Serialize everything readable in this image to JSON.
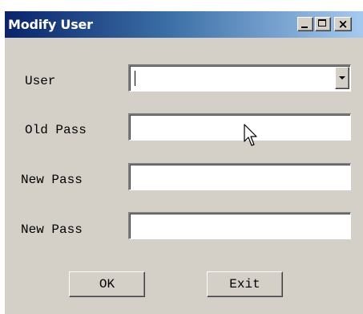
{
  "window": {
    "title": "Modify User",
    "titlebar_gradient": [
      "#0a246a",
      "#a6caf0"
    ],
    "background": "#d4d0c8"
  },
  "title_buttons": {
    "minimize_icon": "minimize-icon",
    "maximize_icon": "maximize-icon",
    "close_icon": "close-icon",
    "close_glyph": "×"
  },
  "form": {
    "user_label": "User",
    "user_value": "",
    "old_pass_label": "Old Pass",
    "old_pass_value": "",
    "new_pass_label": "New Pass",
    "new_pass_value": "",
    "confirm_pass_label": "New Pass",
    "confirm_pass_value": ""
  },
  "buttons": {
    "ok_label": "OK",
    "exit_label": "Exit"
  }
}
